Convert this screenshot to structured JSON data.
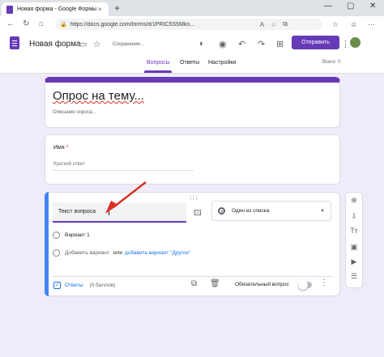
{
  "browser": {
    "tab_title": "Новая форма - Google Формы",
    "tab_close": "×",
    "new_tab": "+",
    "url": "https://docs.google.com/forms/d/1PRIC5S5Mko...",
    "min": "—",
    "max": "▢",
    "close": "✕"
  },
  "header": {
    "form_title": "Новая форма",
    "saving": "Сохранение...",
    "send_label": "Отправить",
    "tabs": [
      "Вопросы",
      "Ответы",
      "Настройки"
    ],
    "total": "Всего: 0"
  },
  "title_card": {
    "title": "Опрос на тему...",
    "description": "Описание опроса..."
  },
  "name_card": {
    "question": "Имя",
    "required_mark": "*",
    "answer_placeholder": "Краткий ответ"
  },
  "active_card": {
    "drag": "⁝⁝⁝",
    "question_text": "Текст вопроса",
    "type_label": "Один из списка",
    "option1": "Вариант 1",
    "add_option": "Добавить вариант",
    "or": "или",
    "add_other": "добавить вариант \"Другое\"",
    "answers_label": "Ответы",
    "points": "(0 баллов)",
    "required_label": "Обязательный вопрос"
  },
  "colors": {
    "accent": "#673ab7",
    "arrow": "#d93025",
    "link": "#1a73e8",
    "background": "#f0ebf8"
  }
}
